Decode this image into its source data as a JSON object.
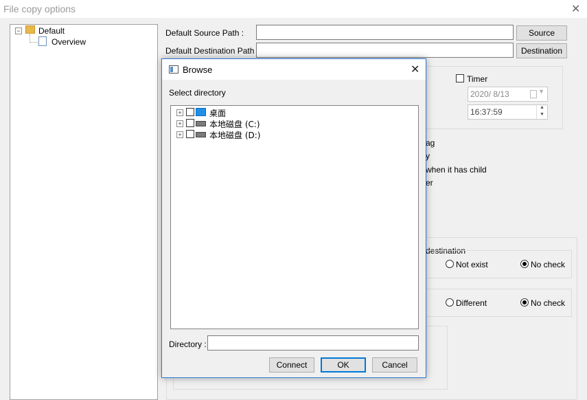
{
  "window": {
    "title": "File copy options",
    "close_glyph": "✕"
  },
  "tree": {
    "root": "Default",
    "child": "Overview",
    "expander": "−"
  },
  "form": {
    "source_label": "Default Source Path :",
    "source_value": "",
    "source_button": "Source",
    "dest_label": "Default Destination Path :",
    "dest_value": "",
    "dest_button": "Destination",
    "timer_label": "Timer",
    "date_value": "2020/  8/13",
    "time_value": "16:37:59",
    "frag1": "ag",
    "frag2": "y",
    "frag3": "when it has child",
    "frag4": "er",
    "group_dest_title": "destination",
    "radio_not_exist": "Not exist",
    "radio_no_check_1": "No check",
    "radio_different": "Different",
    "radio_no_check_2": "No check"
  },
  "dialog": {
    "title": "Browse",
    "close_glyph": "✕",
    "select_label": "Select directory",
    "items": [
      "桌面",
      "本地磁盘 (C:)",
      "本地磁盘 (D:)"
    ],
    "expander": "+",
    "directory_label": "Directory :",
    "directory_value": "",
    "connect_button": "Connect",
    "ok_button": "OK",
    "cancel_button": "Cancel"
  },
  "colors": {
    "accent": "#0078d7",
    "dialog_border": "#2b79d4"
  }
}
